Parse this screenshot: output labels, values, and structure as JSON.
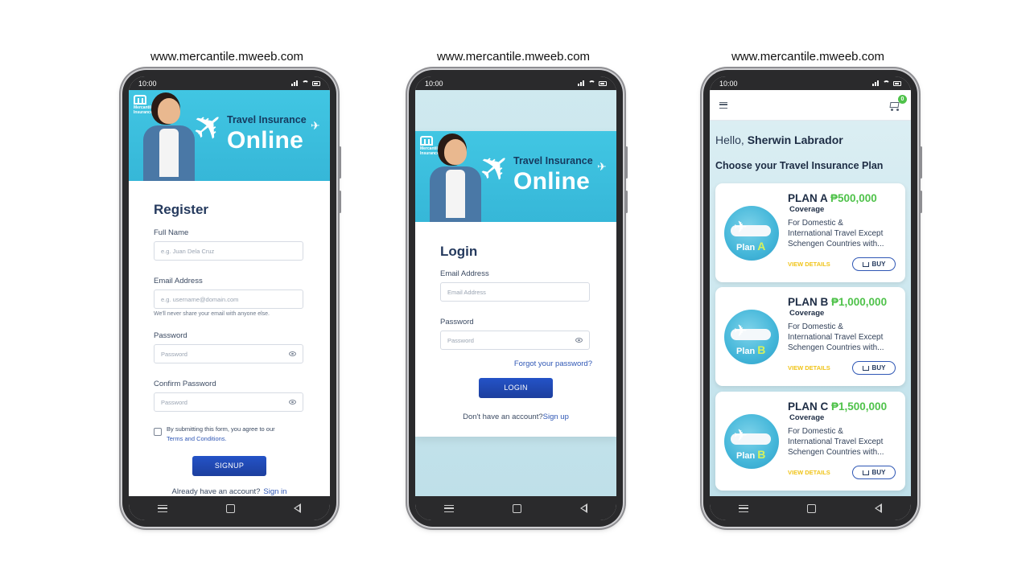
{
  "site_url": "www.mercantile.mweeb.com",
  "status_time": "10:00",
  "banner": {
    "title_line1": "Travel Insurance",
    "title_line2": "Online",
    "logo_line1": "Mercantile",
    "logo_line2": "Insurance"
  },
  "register": {
    "heading": "Register",
    "full_name_label": "Full Name",
    "full_name_placeholder": "e.g. Juan Dela Cruz",
    "email_label": "Email Address",
    "email_placeholder": "e.g. username@domain.com",
    "email_help": "We'll never share your email with anyone else.",
    "password_label": "Password",
    "password_placeholder": "Password",
    "confirm_label": "Confirm Password",
    "confirm_placeholder": "Password",
    "terms_text": "By submitting this form, you agree to our",
    "terms_link": "Terms and Conditions.",
    "signup_button": "SIGNUP",
    "footer_text": "Already have an account?",
    "footer_link": "Sign in"
  },
  "login": {
    "heading": "Login",
    "email_label": "Email Address",
    "email_placeholder": "Email Address",
    "password_label": "Password",
    "password_placeholder": "Password",
    "forgot_link": "Forgot your password?",
    "login_button": "LOGIN",
    "footer_text": "Don't have an account?",
    "footer_link": "Sign up"
  },
  "plans": {
    "cart_count": "0",
    "hello_prefix": "Hello,",
    "user_name": "Sherwin Labrador",
    "choose_heading": "Choose your Travel Insurance Plan",
    "view_details": "VIEW DETAILS",
    "buy_label": "BUY",
    "coverage_label": "Coverage",
    "items": [
      {
        "name": "PLAN A",
        "amount": "₱500,000",
        "icon_letter": "A",
        "icon_word": "Plan",
        "desc1": "For Domestic &",
        "desc2": "International Travel Except",
        "desc3": "Schengen Countries with..."
      },
      {
        "name": "PLAN B",
        "amount": "₱1,000,000",
        "icon_letter": "B",
        "icon_word": "Plan",
        "desc1": "For Domestic &",
        "desc2": "International Travel Except",
        "desc3": "Schengen Countries with..."
      },
      {
        "name": "PLAN C",
        "amount": "₱1,500,000",
        "icon_letter": "B",
        "icon_word": "Plan",
        "desc1": "For Domestic &",
        "desc2": "International Travel Except",
        "desc3": "Schengen Countries with..."
      }
    ]
  },
  "colors": {
    "brand_blue": "#2453c7",
    "banner_cyan": "#41c6e3",
    "plan_green": "#4fc24a",
    "view_yellow": "#f0c419"
  }
}
